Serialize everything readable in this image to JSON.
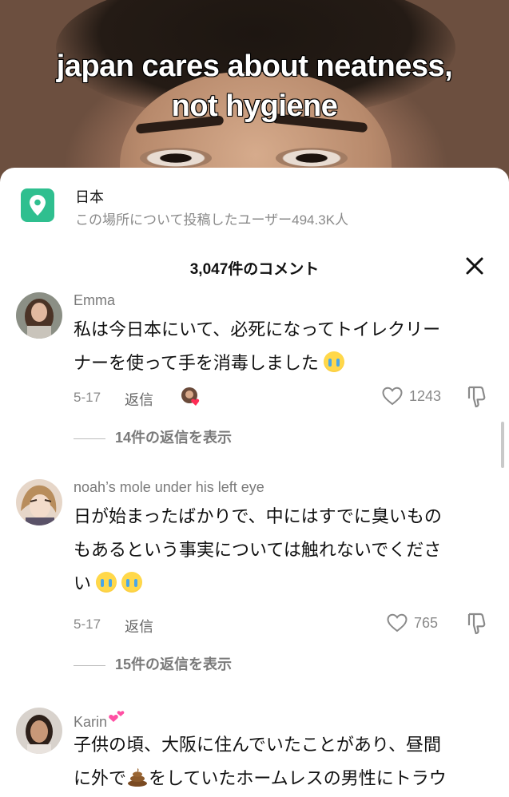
{
  "video": {
    "caption_line1": "japan cares about neatness,",
    "caption_line2": "not hygiene"
  },
  "location": {
    "title": "日本",
    "subtitle": "この場所について投稿したユーザー494.3K人",
    "icon": "map-pin-icon",
    "accent_color": "#2fbf8f"
  },
  "comments_header": {
    "count_label": "3,047件のコメント",
    "close_icon": "close-icon"
  },
  "comments": [
    {
      "name": "Emma",
      "text_line1": "私は今日本にいて、必死になってトイレクリー",
      "text_line2": "ナーを使って手を消毒しました",
      "date": "5-17",
      "reply_label": "返信",
      "likes": "1243",
      "view_replies": "14件の返信を表示"
    },
    {
      "name": "noah’s mole under his left eye",
      "text_line1": "日が始まったばかりで、中にはすでに臭いもの",
      "text_line2": "もあるという事実については触れないでくださ",
      "text_line3": "い",
      "date": "5-17",
      "reply_label": "返信",
      "likes": "765",
      "view_replies": "15件の返信を表示"
    },
    {
      "name": "Karin",
      "text_line1": "子供の頃、大阪に住んでいたことがあり、昼間",
      "text_line2a": "に外で",
      "text_line2b": "をしていたホームレスの男性にトラウ"
    }
  ]
}
